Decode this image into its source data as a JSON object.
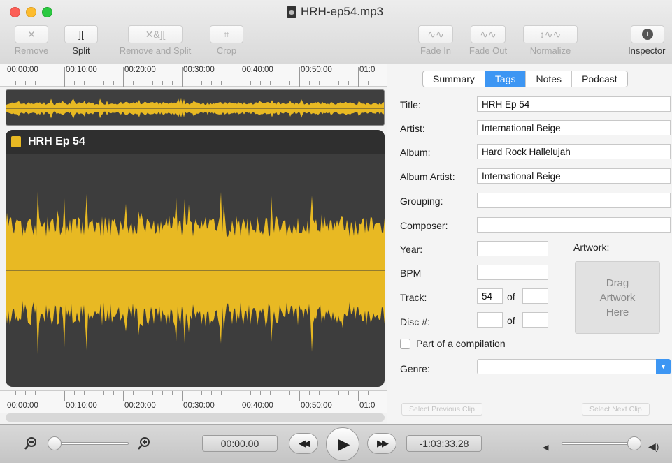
{
  "window": {
    "title": "HRH-ep54.mp3"
  },
  "toolbar": {
    "remove": "Remove",
    "split": "Split",
    "remove_and_split": "Remove and Split",
    "crop": "Crop",
    "fade_in": "Fade In",
    "fade_out": "Fade Out",
    "normalize": "Normalize",
    "inspector": "Inspector"
  },
  "timeline": {
    "top_ticks": [
      "00:00:00",
      "00:10:00",
      "00:20:00",
      "00:30:00",
      "00:40:00",
      "00:50:00",
      "01:0"
    ],
    "bottom_ticks": [
      "00:00:00",
      "00:10:00",
      "00:20:00",
      "00:30:00",
      "00:40:00",
      "00:50:00",
      "01:0"
    ]
  },
  "clip": {
    "name": "HRH Ep 54",
    "waveform_color": "#e8b923"
  },
  "inspector": {
    "tabs": [
      "Summary",
      "Tags",
      "Notes",
      "Podcast"
    ],
    "selected_tab": "Tags",
    "labels": {
      "title": "Title:",
      "artist": "Artist:",
      "album": "Album:",
      "album_artist": "Album Artist:",
      "grouping": "Grouping:",
      "composer": "Composer:",
      "year": "Year:",
      "bpm": "BPM",
      "track": "Track:",
      "disc": "Disc #:",
      "of": "of",
      "artwork": "Artwork:",
      "compilation": "Part of a compilation",
      "genre": "Genre:"
    },
    "values": {
      "title": "HRH Ep 54",
      "artist": "International Beige",
      "album": "Hard Rock Hallelujah",
      "album_artist": "International Beige",
      "grouping": "",
      "composer": "",
      "year": "",
      "bpm": "",
      "track": "54",
      "track_of": "",
      "disc": "",
      "disc_of": "",
      "genre": ""
    },
    "artwork_placeholder": "Drag Artwork Here",
    "select_previous": "Select Previous Clip",
    "select_next": "Select Next Clip"
  },
  "playback": {
    "current_time": "00:00.00",
    "remaining_time": "-1:03:33.28"
  }
}
